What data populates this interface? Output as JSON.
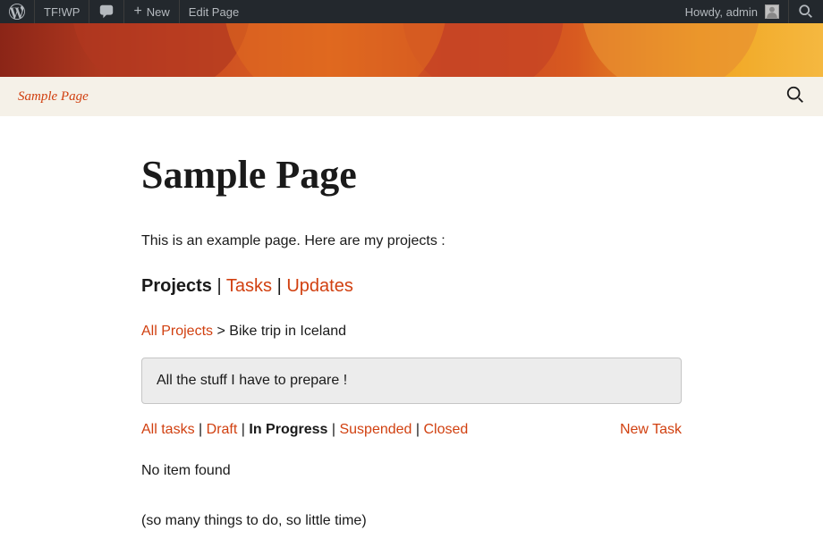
{
  "admin_bar": {
    "site_name": "TF!WP",
    "new_label": "New",
    "edit_page_label": "Edit Page",
    "greeting": "Howdy, admin"
  },
  "nav": {
    "sample_page": "Sample Page"
  },
  "page": {
    "title": "Sample Page",
    "intro": "This is an example page. Here are my projects :"
  },
  "tabs": {
    "projects": "Projects",
    "tasks": "Tasks",
    "updates": "Updates"
  },
  "breadcrumb": {
    "all_projects": "All Projects",
    "separator": ">",
    "current": "Bike trip in Iceland"
  },
  "info_box": "All the stuff I have to prepare !",
  "filters": {
    "all_tasks": "All tasks",
    "draft": "Draft",
    "in_progress": "In Progress",
    "suspended": "Suspended",
    "closed": "Closed"
  },
  "actions": {
    "new_task": "New Task"
  },
  "results": {
    "no_item": "No item found",
    "footnote": "(so many things to do, so little time)"
  }
}
